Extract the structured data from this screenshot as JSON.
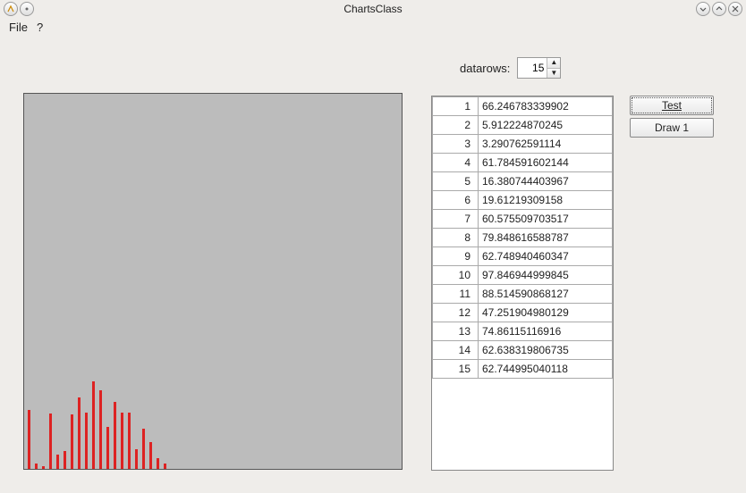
{
  "window": {
    "title": "ChartsClass"
  },
  "menu": {
    "file": "File",
    "help": "?"
  },
  "datarows": {
    "label": "datarows:",
    "value": "15"
  },
  "buttons": {
    "test": "Test",
    "draw1": "Draw 1"
  },
  "table": {
    "rows": [
      {
        "i": "1",
        "v": "66.246783339902"
      },
      {
        "i": "2",
        "v": "5.912224870245"
      },
      {
        "i": "3",
        "v": "3.290762591114"
      },
      {
        "i": "4",
        "v": "61.784591602144"
      },
      {
        "i": "5",
        "v": "16.380744403967"
      },
      {
        "i": "6",
        "v": "19.61219309158"
      },
      {
        "i": "7",
        "v": "60.575509703517"
      },
      {
        "i": "8",
        "v": "79.848616588787"
      },
      {
        "i": "9",
        "v": "62.748940460347"
      },
      {
        "i": "10",
        "v": "97.846944999845"
      },
      {
        "i": "11",
        "v": "88.514590868127"
      },
      {
        "i": "12",
        "v": "47.251904980129"
      },
      {
        "i": "13",
        "v": "74.86115116916"
      },
      {
        "i": "14",
        "v": "62.638319806735"
      },
      {
        "i": "15",
        "v": "62.744995040118"
      }
    ]
  },
  "chart_data": {
    "type": "bar",
    "categories": [
      "1",
      "2",
      "3",
      "4",
      "5",
      "6",
      "7",
      "8",
      "9",
      "10",
      "11",
      "12",
      "13",
      "14",
      "15"
    ],
    "values": [
      66.25,
      5.91,
      3.29,
      61.78,
      16.38,
      19.61,
      60.58,
      79.85,
      62.75,
      97.85,
      88.51,
      47.25,
      74.86,
      62.64,
      62.74
    ],
    "extra_values": [
      22,
      45,
      30,
      12,
      6
    ],
    "title": "",
    "xlabel": "",
    "ylabel": "",
    "ylim": [
      0,
      100
    ],
    "color": "#dd2222"
  }
}
